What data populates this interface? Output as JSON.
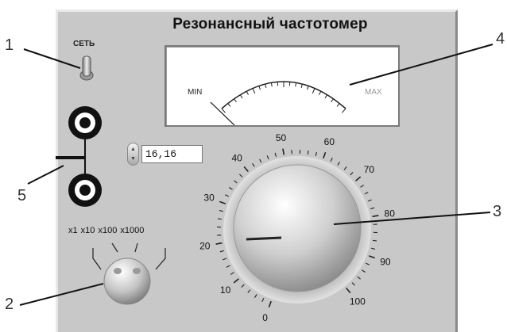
{
  "window": {
    "title": "Резонансный частотомер"
  },
  "power_switch": {
    "label": "СЕТЬ"
  },
  "meter": {
    "min_label": "MIN",
    "max_label": "MAX"
  },
  "frequency_input": {
    "value": "16,16"
  },
  "range_selector": {
    "labels": [
      "х1",
      "х10",
      "х100",
      "х1000"
    ],
    "label_text": "х1 х10  х100 х1000"
  },
  "main_dial": {
    "scale_labels": [
      "0",
      "10",
      "20",
      "30",
      "40",
      "50",
      "60",
      "70",
      "80",
      "90",
      "100"
    ]
  },
  "callouts": [
    "1",
    "2",
    "3",
    "4",
    "5"
  ],
  "colors": {
    "panel": "#c8c8c8",
    "meter_bg": "#ffffff",
    "text": "#111111"
  },
  "icons": {
    "power": "toggle-switch-icon",
    "terminal": "binding-post-icon"
  }
}
